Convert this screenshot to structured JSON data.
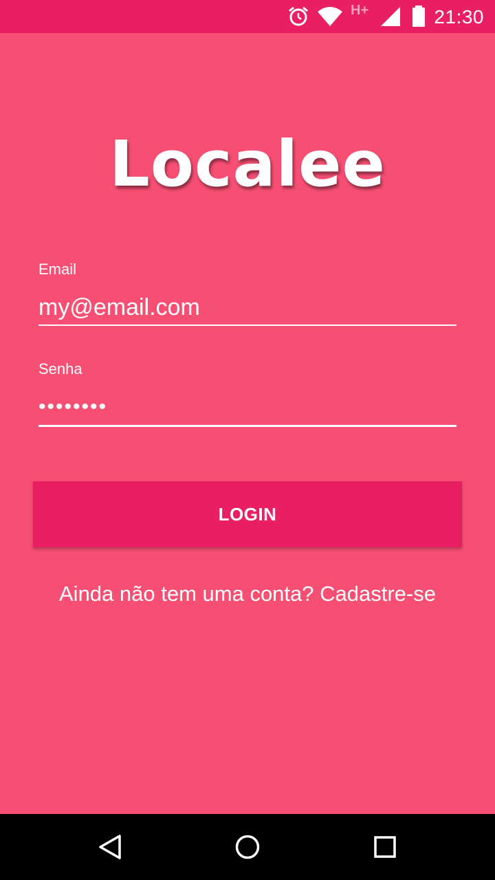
{
  "status_bar": {
    "time": "21:30",
    "network_type": "H+",
    "icons": [
      "alarm-icon",
      "wifi-icon",
      "signal-icon",
      "battery-icon"
    ]
  },
  "app": {
    "logo_text": "Localee"
  },
  "form": {
    "email_label": "Email",
    "email_value": "my@email.com",
    "password_label": "Senha",
    "password_value": "••••••••"
  },
  "login_button_label": "LOGIN",
  "signup_link_text": "Ainda não tem uma conta? Cadastre-se",
  "nav_bar": {
    "icons": [
      "back-icon",
      "home-icon",
      "recent-apps-icon"
    ]
  },
  "colors": {
    "background": "#f64f73",
    "status_bar": "#e91e63",
    "button": "#e91e63",
    "nav_bar": "#000000",
    "text": "#ffffff"
  }
}
